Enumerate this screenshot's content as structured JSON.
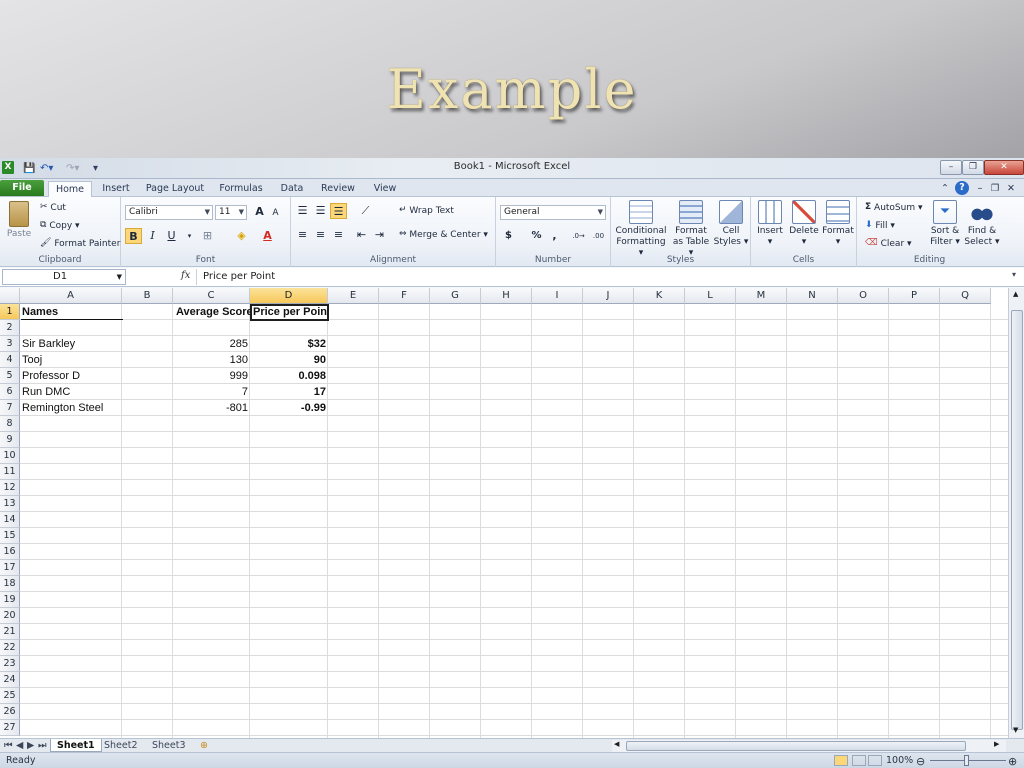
{
  "slide": {
    "title": "Example"
  },
  "window": {
    "title": "Book1  -  Microsoft Excel",
    "minimize": "–",
    "restore": "❐",
    "close": "✕"
  },
  "ribbon": {
    "tabs": [
      "File",
      "Home",
      "Insert",
      "Page Layout",
      "Formulas",
      "Data",
      "Review",
      "View"
    ],
    "clipboard": {
      "paste": "Paste",
      "cut": "Cut",
      "copy": "Copy",
      "format_painter": "Format Painter",
      "label": "Clipboard"
    },
    "font": {
      "name": "Calibri",
      "size": "11",
      "bold": "B",
      "italic": "I",
      "underline": "U",
      "label": "Font",
      "grow": "A",
      "shrink": "A"
    },
    "alignment": {
      "wrap_text": "Wrap Text",
      "merge_center": "Merge & Center",
      "label": "Alignment"
    },
    "number": {
      "format": "General",
      "currency": "$",
      "percent": "%",
      "comma": ",",
      "label": "Number"
    },
    "styles": {
      "conditional": "Conditional",
      "conditional2": "Formatting",
      "format_as": "Format",
      "format_as2": "as Table",
      "cell": "Cell",
      "cell2": "Styles",
      "label": "Styles"
    },
    "cells": {
      "insert": "Insert",
      "delete": "Delete",
      "format": "Format",
      "label": "Cells"
    },
    "editing": {
      "autosum": "AutoSum",
      "fill": "Fill",
      "clear": "Clear",
      "sort": "Sort &",
      "sort2": "Filter",
      "find": "Find &",
      "find2": "Select",
      "label": "Editing"
    }
  },
  "formula_bar": {
    "name_box": "D1",
    "fx": "fx",
    "content": "Price per Point"
  },
  "sheet": {
    "columns": [
      "A",
      "B",
      "C",
      "D",
      "E",
      "F",
      "G",
      "H",
      "I",
      "J",
      "K",
      "L",
      "M",
      "N",
      "O",
      "P",
      "Q"
    ],
    "rows": [
      "1",
      "2",
      "3",
      "4",
      "5",
      "6",
      "7",
      "8",
      "9",
      "10",
      "11",
      "12",
      "13",
      "14",
      "15",
      "16",
      "17",
      "18",
      "19",
      "20",
      "21",
      "22",
      "23",
      "24",
      "25",
      "26",
      "27"
    ],
    "headers": {
      "names": "Names",
      "average_score": "Average Score",
      "price_per_point": "Price per Point"
    },
    "data": [
      {
        "name": "Sir Barkley",
        "score": "285",
        "price": "$32"
      },
      {
        "name": "Tooj",
        "score": "130",
        "price": "90"
      },
      {
        "name": "Professor D",
        "score": "999",
        "price": "0.098"
      },
      {
        "name": "Run DMC",
        "score": "7",
        "price": "17"
      },
      {
        "name": "Remington Steel",
        "score": "-801",
        "price": "-0.99"
      }
    ]
  },
  "sheet_tabs": [
    "Sheet1",
    "Sheet2",
    "Sheet3"
  ],
  "status": {
    "ready": "Ready",
    "zoom": "100%"
  },
  "colors": {
    "file_tab": "#287a1e",
    "selected_header": "#f6c85a",
    "title_text": "#efe3b4"
  }
}
